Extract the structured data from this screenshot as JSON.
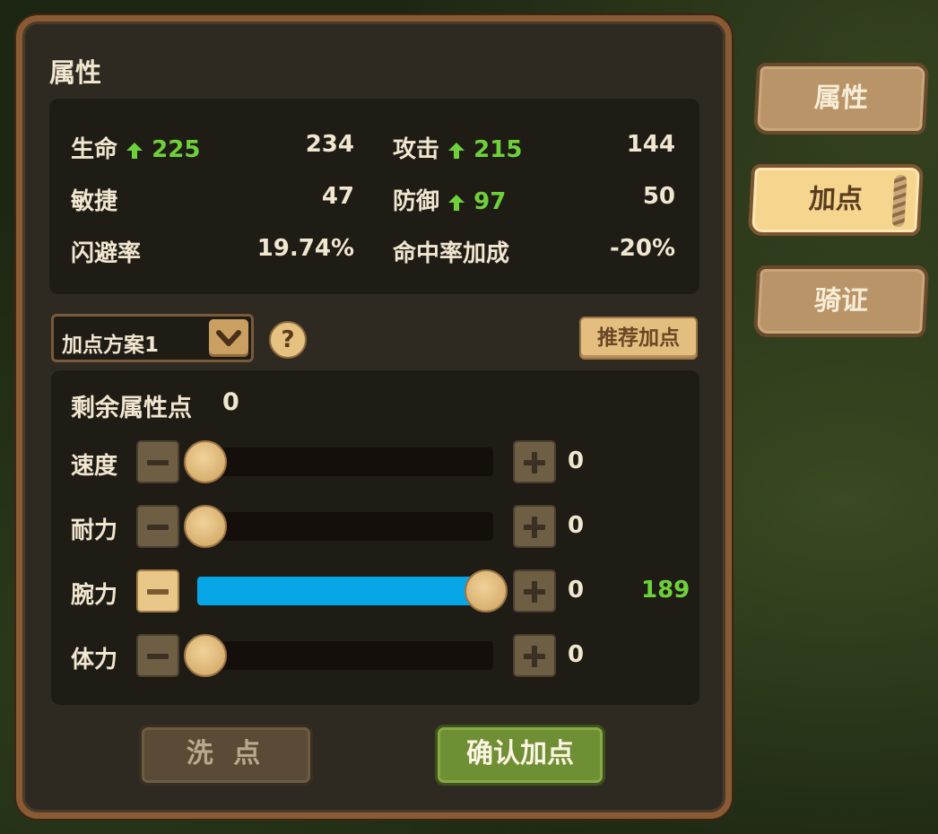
{
  "panel": {
    "title": "属性"
  },
  "stats": [
    {
      "label": "生命",
      "bonus": "225",
      "value": "234"
    },
    {
      "label": "攻击",
      "bonus": "215",
      "value": "144"
    },
    {
      "label": "敏捷",
      "bonus": "",
      "value": "47"
    },
    {
      "label": "防御",
      "bonus": "97",
      "value": "50"
    },
    {
      "label": "闪避率",
      "bonus": "",
      "value": "19.74%"
    },
    {
      "label": "命中率加成",
      "bonus": "",
      "value": "-20%"
    }
  ],
  "scheme": {
    "selected": "加点方案1"
  },
  "recommend_label": "推荐加点",
  "remaining": {
    "label": "剩余属性点",
    "value": "0"
  },
  "sliders": [
    {
      "label": "速度",
      "value": "0",
      "extra": "",
      "fill_fraction": 0
    },
    {
      "label": "耐力",
      "value": "0",
      "extra": "",
      "fill_fraction": 0
    },
    {
      "label": "腕力",
      "value": "0",
      "extra": "189",
      "fill_fraction": 1
    },
    {
      "label": "体力",
      "value": "0",
      "extra": "",
      "fill_fraction": 0
    }
  ],
  "buttons": {
    "reset": "洗 点",
    "confirm": "确认加点"
  },
  "tabs": [
    {
      "label": "属性",
      "active": false
    },
    {
      "label": "加点",
      "active": true
    },
    {
      "label": "骑证",
      "active": false
    }
  ],
  "colors": {
    "bonus_green": "#6fd13a",
    "slider_fill": "#07a6e6"
  }
}
